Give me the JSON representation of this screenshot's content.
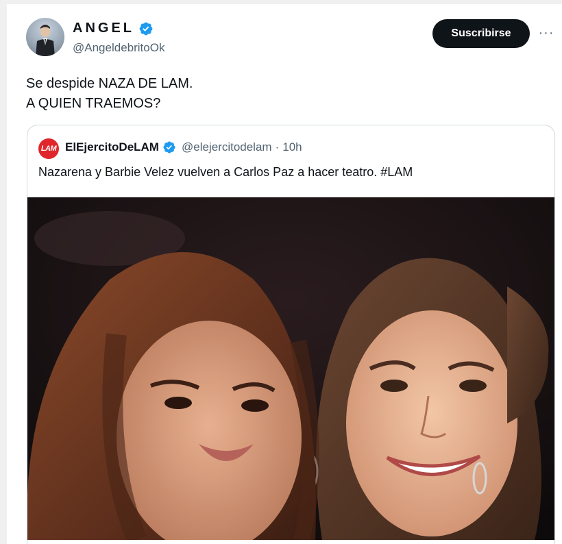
{
  "author": {
    "display_name": "ANGEL",
    "handle": "@AngeldebritoOk",
    "verified_icon": "verified-badge-icon"
  },
  "actions": {
    "subscribe_label": "Suscribirse",
    "more_label": "···"
  },
  "tweet": {
    "lines": [
      "Se despide NAZA DE LAM.",
      "A QUIEN TRAEMOS?"
    ]
  },
  "quoted": {
    "avatar_text": "LAM",
    "display_name": "ElEjercitoDeLAM",
    "handle": "@elejercitodelam",
    "separator": "·",
    "time": "10h",
    "text": "Nazarena y Barbie Velez vuelven a Carlos Paz a hacer teatro. #LAM"
  },
  "colors": {
    "subscribe_bg": "#0f1419",
    "verified_blue": "#1d9bf0",
    "lam_red": "#e0262b",
    "secondary_text": "#536471"
  }
}
